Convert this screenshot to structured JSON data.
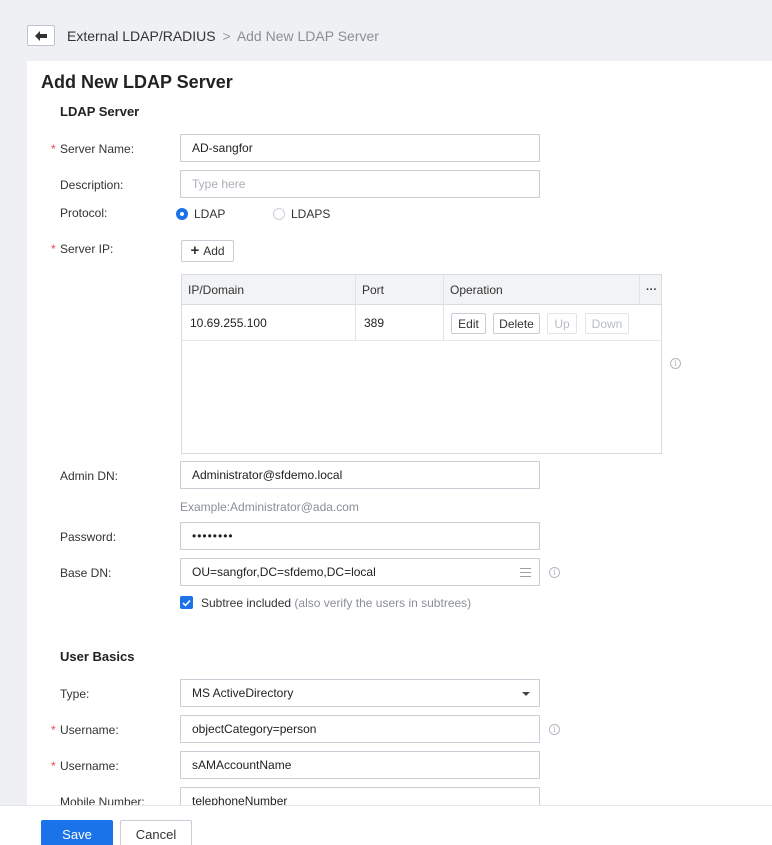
{
  "breadcrumb": {
    "parent": "External LDAP/RADIUS",
    "separator": ">",
    "current": "Add New LDAP Server"
  },
  "page": {
    "title": "Add New LDAP Server"
  },
  "ldap_section": {
    "title": "LDAP Server",
    "server_name": {
      "label": "Server Name:",
      "value": "AD-sangfor",
      "required": true
    },
    "description": {
      "label": "Description:",
      "placeholder": "Type here"
    },
    "protocol": {
      "label": "Protocol:",
      "options": [
        "LDAP",
        "LDAPS"
      ],
      "selected": "LDAP"
    },
    "server_ip": {
      "label": "Server IP:",
      "add_label": "Add",
      "columns": [
        "IP/Domain",
        "Port",
        "Operation"
      ],
      "more_label": "···",
      "rows": [
        {
          "ip": "10.69.255.100",
          "port": "389"
        }
      ],
      "actions": {
        "edit": "Edit",
        "delete": "Delete",
        "up": "Up",
        "down": "Down"
      }
    },
    "admin_dn": {
      "label": "Admin DN:",
      "value": "Administrator@sfdemo.local",
      "hint": "Example:Administrator@ada.com"
    },
    "password": {
      "label": "Password:",
      "value": "••••••••"
    },
    "base_dn": {
      "label": "Base DN:",
      "value": "OU=sangfor,DC=sfdemo,DC=local"
    },
    "subtree": {
      "label": "Subtree included",
      "note": "(also verify the users in subtrees)",
      "checked": true
    }
  },
  "user_basics": {
    "title": "User Basics",
    "type": {
      "label": "Type:",
      "value": "MS ActiveDirectory"
    },
    "username_filter": {
      "label": "Username:",
      "value": "objectCategory=person"
    },
    "username_attr": {
      "label": "Username:",
      "value": "sAMAccountName"
    },
    "mobile": {
      "label": "Mobile Number:",
      "value": "telephoneNumber"
    }
  },
  "footer": {
    "save": "Save",
    "cancel": "Cancel"
  },
  "colors": {
    "accent": "#1a73e8",
    "required": "#e5484d"
  }
}
